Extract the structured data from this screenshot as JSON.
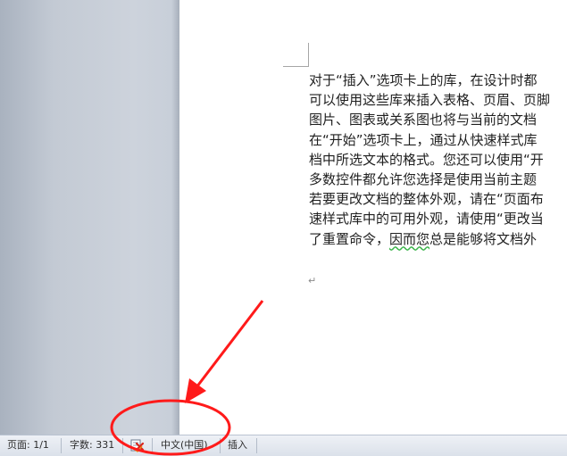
{
  "document": {
    "lines": [
      {
        "text": "对于“插入”选项卡上的库，在设计时都"
      },
      {
        "text": "可以使用这些库来插入表格、页眉、页脚"
      },
      {
        "text": "图片、图表或关系图也将与当前的文档"
      },
      {
        "text": "在“开始”选项卡上，通过从快速样式库"
      },
      {
        "text": "档中所选文本的格式。您还可以使用“开"
      },
      {
        "text": "多数控件都允许您选择是使用当前主题"
      },
      {
        "text": "若要更改文档的整体外观，请在“页面布"
      },
      {
        "text": "速样式库中的可用外观，请使用“更改当"
      }
    ],
    "last_line": {
      "before": "了重置命令，",
      "squiggle": "因而您",
      "after": "总是能够将文档外"
    },
    "paragraph_mark": "↵"
  },
  "statusbar": {
    "page_label": "页面: 1/1",
    "word_count_label": "字数: 331",
    "language_label": "中文(中国)",
    "mode_label": "插入",
    "spell_icon": "proofing-error-icon"
  },
  "colors": {
    "annotation": "#ff1a1a",
    "squiggle": "#3cb44b",
    "statusbar_bg": "#dbe1ea",
    "workspace_bg": "#c3cad4"
  }
}
